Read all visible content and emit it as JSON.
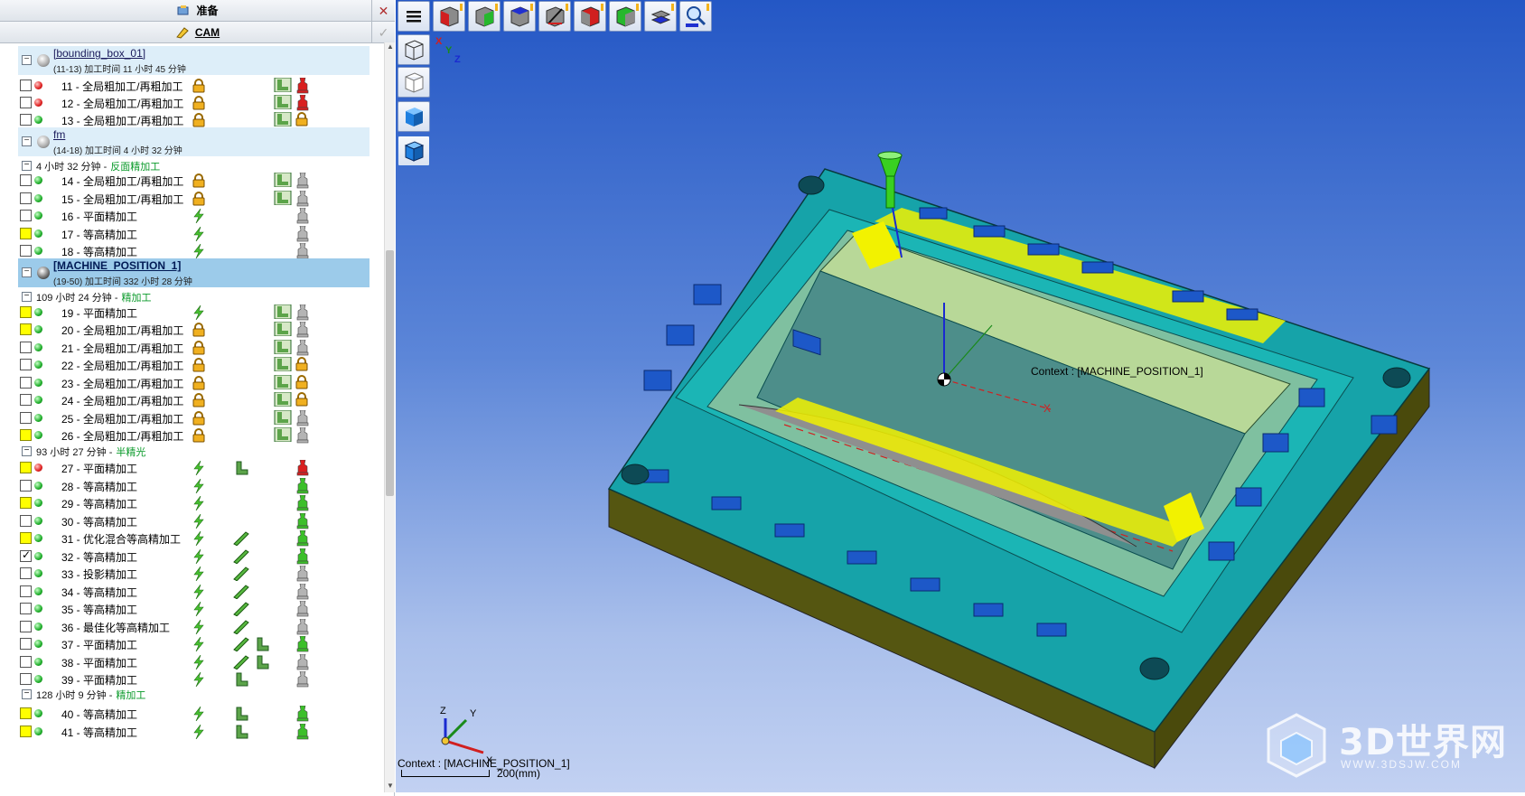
{
  "left_panel": {
    "prep_label": "准备",
    "cam_label": "CAM",
    "groups": [
      {
        "name": "[bounding_box_01]",
        "sub": "(11-13) 加工时间 11 小时 45 分钟"
      },
      {
        "name": "fm",
        "sub": "(14-18) 加工时间 4 小时 32 分钟"
      },
      {
        "name": "[MACHINE_POSITION_1]",
        "sub": "(19-50) 加工时间 332 小时 28 分钟"
      }
    ],
    "sections": [
      {
        "time": "4 小时 32 分钟 -",
        "type": "反面精加工"
      },
      {
        "time": "109 小时 24 分钟 -",
        "type": "精加工"
      },
      {
        "time": "93 小时 27 分钟 -",
        "type": "半精光"
      },
      {
        "time": "128 小时 9 分钟 -",
        "type": "精加工"
      }
    ],
    "ops": [
      "11 - 全局粗加工/再粗加工",
      "12 - 全局粗加工/再粗加工",
      "13 - 全局粗加工/再粗加工",
      "14 - 全局粗加工/再粗加工",
      "15 - 全局粗加工/再粗加工",
      "16 - 平面精加工",
      "17 - 等高精加工",
      "18 - 等高精加工",
      "19 - 平面精加工",
      "20 - 全局粗加工/再粗加工",
      "21 - 全局粗加工/再粗加工",
      "22 - 全局粗加工/再粗加工",
      "23 - 全局粗加工/再粗加工",
      "24 - 全局粗加工/再粗加工",
      "25 - 全局粗加工/再粗加工",
      "26 - 全局粗加工/再粗加工",
      "27 - 平面精加工",
      "28 - 等高精加工",
      "29 - 等高精加工",
      "30 - 等高精加工",
      "31 - 优化混合等高精加工",
      "32 - 等高精加工",
      "33 - 投影精加工",
      "34 - 等高精加工",
      "35 - 等高精加工",
      "36 - 最佳化等高精加工",
      "37 - 平面精加工",
      "38 - 平面精加工",
      "39 - 平面精加工",
      "40 - 等高精加工",
      "41 - 等高精加工"
    ]
  },
  "viewport": {
    "context_label": "Context : [MACHINE_POSITION_1]",
    "context_bottom": "Context : [MACHINE_POSITION_1]",
    "scale_label": "200(mm)",
    "axis_labels": {
      "x": "X",
      "y": "Y",
      "z": "Z"
    },
    "watermark_title": "3D世界网",
    "watermark_url": "WWW.3DSJW.COM"
  },
  "colors": {
    "mold_top": "#16a3a9",
    "mold_side": "#5c5a0a",
    "highlight": "#f2f200",
    "cavity": "#9ec58a",
    "tool_green": "#39d021",
    "viewport_top": "#2457c5",
    "viewport_bottom": "#c2d1f2",
    "selection": "#9ccbea"
  }
}
